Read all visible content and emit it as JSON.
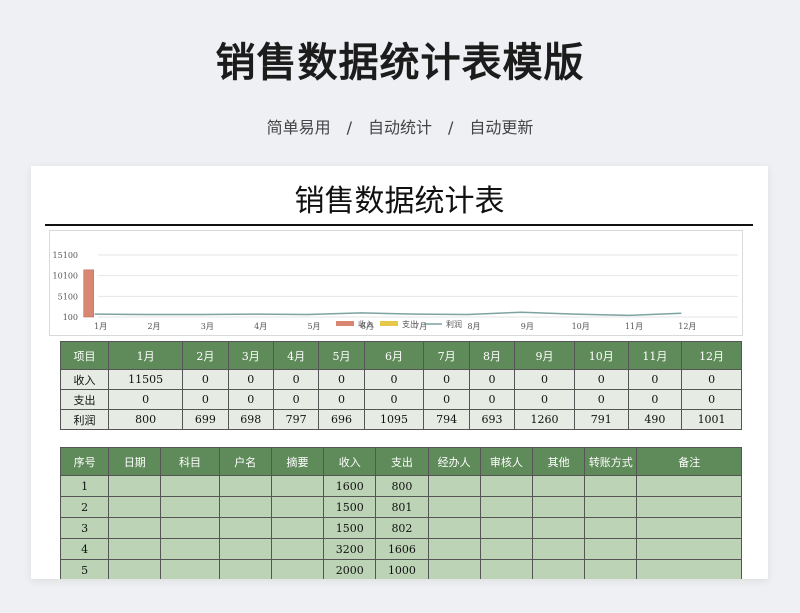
{
  "header": {
    "title": "销售数据统计表模版",
    "subtitle": "简单易用　/　自动统计　/　自动更新"
  },
  "sheet": {
    "title": "销售数据统计表"
  },
  "chart_data": {
    "type": "bar",
    "categories": [
      "1月",
      "2月",
      "3月",
      "4月",
      "5月",
      "6月",
      "7月",
      "8月",
      "9月",
      "10月",
      "11月",
      "12月"
    ],
    "series": [
      {
        "name": "收入",
        "kind": "bar",
        "color": "#d98673",
        "values": [
          11505,
          0,
          0,
          0,
          0,
          0,
          0,
          0,
          0,
          0,
          0,
          0
        ]
      },
      {
        "name": "支出",
        "kind": "bar",
        "color": "#e6c84a",
        "values": [
          0,
          0,
          0,
          0,
          0,
          0,
          0,
          0,
          0,
          0,
          0,
          0
        ]
      },
      {
        "name": "利润",
        "kind": "line",
        "color": "#7da3a1",
        "values": [
          800,
          699,
          698,
          797,
          696,
          1095,
          794,
          693,
          1260,
          791,
          490,
          1001
        ]
      }
    ],
    "yticks": [
      "15100",
      "10100",
      "5100",
      "100"
    ],
    "ylim": [
      100,
      15100
    ],
    "legend": "bottom-center"
  },
  "summary": {
    "headers": [
      "项目",
      "1月",
      "2月",
      "3月",
      "4月",
      "5月",
      "6月",
      "7月",
      "8月",
      "9月",
      "10月",
      "11月",
      "12月"
    ],
    "rows": [
      [
        "收入",
        "11505",
        "0",
        "0",
        "0",
        "0",
        "0",
        "0",
        "0",
        "0",
        "0",
        "0",
        "0"
      ],
      [
        "支出",
        "0",
        "0",
        "0",
        "0",
        "0",
        "0",
        "0",
        "0",
        "0",
        "0",
        "0",
        "0"
      ],
      [
        "利润",
        "800",
        "699",
        "698",
        "797",
        "696",
        "1095",
        "794",
        "693",
        "1260",
        "791",
        "490",
        "1001"
      ]
    ]
  },
  "detail": {
    "headers": [
      "序号",
      "日期",
      "科目",
      "户名",
      "摘要",
      "收入",
      "支出",
      "经办人",
      "审核人",
      "其他",
      "转账方式",
      "备注"
    ],
    "rows": [
      [
        "1",
        "",
        "",
        "",
        "",
        "1600",
        "800",
        "",
        "",
        "",
        "",
        ""
      ],
      [
        "2",
        "",
        "",
        "",
        "",
        "1500",
        "801",
        "",
        "",
        "",
        "",
        ""
      ],
      [
        "3",
        "",
        "",
        "",
        "",
        "1500",
        "802",
        "",
        "",
        "",
        "",
        ""
      ],
      [
        "4",
        "",
        "",
        "",
        "",
        "3200",
        "1606",
        "",
        "",
        "",
        "",
        ""
      ],
      [
        "5",
        "",
        "",
        "",
        "",
        "2000",
        "1000",
        "",
        "",
        "",
        "",
        ""
      ]
    ]
  }
}
